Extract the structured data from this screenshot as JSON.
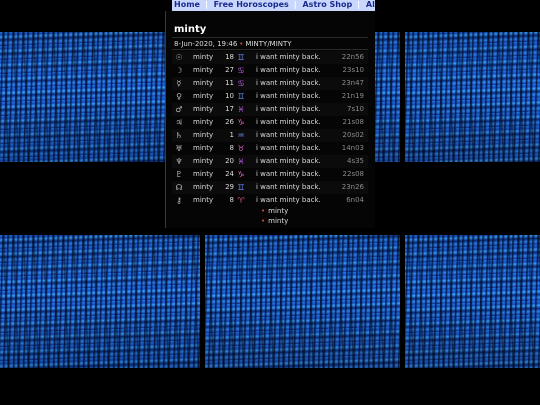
{
  "nav": {
    "items": [
      "Home",
      "Free Horoscopes",
      "Astro Shop",
      "All about Astrology"
    ]
  },
  "post": {
    "title": "minty",
    "date": "8-Jun-2020, 19:46",
    "subject": "MINTY/MINTY"
  },
  "colors": {
    "nav_bg": "#c9d7ff",
    "nav_text": "#1a2a8a",
    "sign_fire": "#e0506a",
    "sign_earth": "#e060c0",
    "sign_air": "#6a8cff",
    "sign_water": "#c060f0",
    "bullet": "#e04545"
  },
  "rows": [
    {
      "planet_icon": "sun-icon",
      "planet": "☉",
      "name": "minty",
      "deg": "18",
      "sign_icon": "gemini-icon",
      "sign": "♊",
      "sign_color": "#6a8cff",
      "text": "i want minty back.",
      "time": "22n56"
    },
    {
      "planet_icon": "moon-icon",
      "planet": "☽",
      "name": "minty",
      "deg": "27",
      "sign_icon": "cancer-icon",
      "sign": "♋",
      "sign_color": "#c060f0",
      "text": "i want minty back.",
      "time": "23s10"
    },
    {
      "planet_icon": "mercury-icon",
      "planet": "☿",
      "name": "minty",
      "deg": "11",
      "sign_icon": "cancer-icon",
      "sign": "♋",
      "sign_color": "#c060f0",
      "text": "i want minty back.",
      "time": "23n47"
    },
    {
      "planet_icon": "venus-icon",
      "planet": "♀",
      "name": "minty",
      "deg": "10",
      "sign_icon": "gemini-icon",
      "sign": "♊",
      "sign_color": "#6a8cff",
      "text": "i want minty back.",
      "time": "21n19"
    },
    {
      "planet_icon": "mars-icon",
      "planet": "♂",
      "name": "minty",
      "deg": "17",
      "sign_icon": "pisces-icon",
      "sign": "♓",
      "sign_color": "#c060f0",
      "text": "i want minty back.",
      "time": "7s10"
    },
    {
      "planet_icon": "jupiter-icon",
      "planet": "♃",
      "name": "minty",
      "deg": "26",
      "sign_icon": "capricorn-icon",
      "sign": "♑",
      "sign_color": "#e060c0",
      "text": "i want minty back.",
      "time": "21s08"
    },
    {
      "planet_icon": "saturn-icon",
      "planet": "♄",
      "name": "minty",
      "deg": "1",
      "sign_icon": "aquarius-icon",
      "sign": "♒",
      "sign_color": "#6a8cff",
      "text": "i want minty back.",
      "time": "20s02"
    },
    {
      "planet_icon": "uranus-icon",
      "planet": "♅",
      "name": "minty",
      "deg": "8",
      "sign_icon": "taurus-icon",
      "sign": "♉",
      "sign_color": "#e060c0",
      "text": "i want minty back.",
      "time": "14n03"
    },
    {
      "planet_icon": "neptune-icon",
      "planet": "♆",
      "name": "minty",
      "deg": "20",
      "sign_icon": "pisces-icon",
      "sign": "♓",
      "sign_color": "#c060f0",
      "text": "i want minty back.",
      "time": "4s35"
    },
    {
      "planet_icon": "pluto-icon",
      "planet": "♇",
      "name": "minty",
      "deg": "24",
      "sign_icon": "capricorn-icon",
      "sign": "♑",
      "sign_color": "#e060c0",
      "text": "i want minty back.",
      "time": "22s08"
    },
    {
      "planet_icon": "node-icon",
      "planet": "☊",
      "name": "minty",
      "deg": "29",
      "sign_icon": "gemini-icon",
      "sign": "♊",
      "sign_color": "#6a8cff",
      "text": "i want minty back.",
      "time": "23n26"
    },
    {
      "planet_icon": "chiron-icon",
      "planet": "⚷",
      "name": "minty",
      "deg": "8",
      "sign_icon": "aries-icon",
      "sign": "♈",
      "sign_color": "#e0506a",
      "text": "i want minty back.",
      "time": "6n04"
    }
  ],
  "footer_links": [
    "minty",
    "minty"
  ]
}
